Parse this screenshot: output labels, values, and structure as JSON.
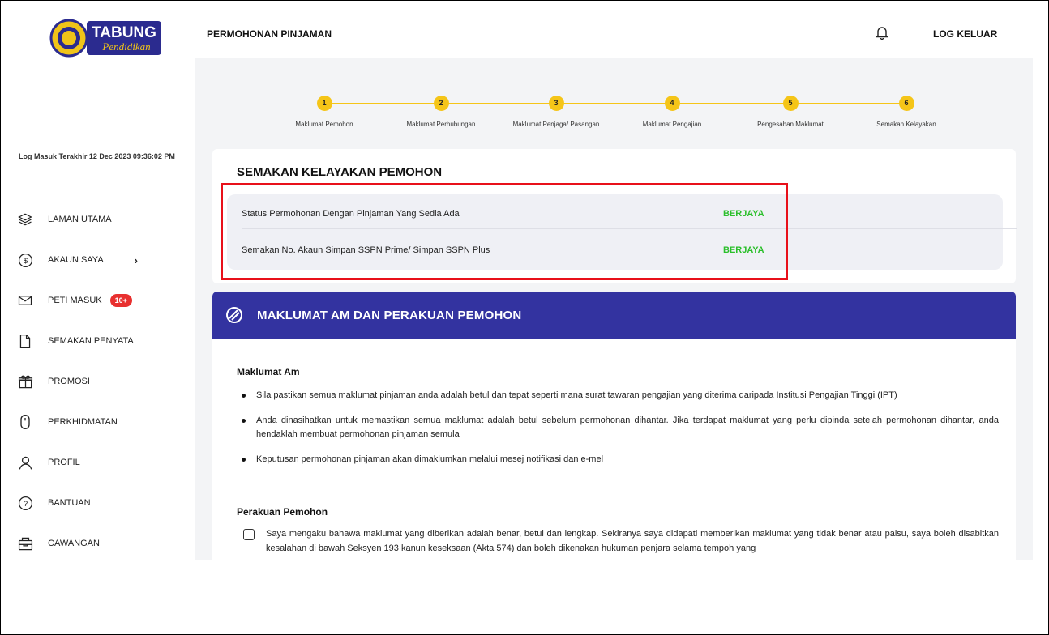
{
  "app": {
    "logo_text": "TABUNG",
    "logo_subtext": "Pendidikan"
  },
  "header": {
    "title": "PERMOHONAN PINJAMAN",
    "logout_label": "LOG KELUAR"
  },
  "sidebar": {
    "last_login": "Log Masuk Terakhir 12 Dec 2023 09:36:02 PM",
    "items": [
      {
        "label": "LAMAN UTAMA",
        "icon": "layers-icon"
      },
      {
        "label": "AKAUN SAYA",
        "icon": "dollar-circle-icon",
        "chevron": "›"
      },
      {
        "label": "PETI MASUK",
        "icon": "mail-icon",
        "badge": "10+"
      },
      {
        "label": "SEMAKAN PENYATA",
        "icon": "file-icon"
      },
      {
        "label": "PROMOSI",
        "icon": "gift-icon"
      },
      {
        "label": "PERKHIDMATAN",
        "icon": "mouse-icon"
      },
      {
        "label": "PROFIL",
        "icon": "user-icon"
      },
      {
        "label": "BANTUAN",
        "icon": "help-icon"
      },
      {
        "label": "CAWANGAN",
        "icon": "building-icon"
      }
    ]
  },
  "stepper": {
    "steps": [
      {
        "num": "1",
        "label": "Maklumat Pemohon"
      },
      {
        "num": "2",
        "label": "Maklumat Perhubungan"
      },
      {
        "num": "3",
        "label": "Maklumat Penjaga/ Pasangan"
      },
      {
        "num": "4",
        "label": "Maklumat Pengajian"
      },
      {
        "num": "5",
        "label": "Pengesahan Maklumat"
      },
      {
        "num": "6",
        "label": "Semakan Kelayakan"
      }
    ],
    "color": "#f5c518"
  },
  "eligibility": {
    "title": "SEMAKAN KELAYAKAN PEMOHON",
    "rows": [
      {
        "label": "Status Permohonan Dengan Pinjaman Yang Sedia Ada",
        "status": "BERJAYA"
      },
      {
        "label": "Semakan No. Akaun Simpan SSPN Prime/ Simpan SSPN Plus",
        "status": "BERJAYA"
      }
    ],
    "status_color": "#2bbf2b"
  },
  "info": {
    "header_title": "MAKLUMAT AM DAN PERAKUAN PEMOHON",
    "section1_title": "Maklumat Am",
    "bullets": [
      "Sila pastikan semua maklumat pinjaman anda adalah betul dan tepat seperti mana surat tawaran pengajian yang diterima daripada Institusi Pengajian Tinggi (IPT)",
      "Anda dinasihatkan untuk memastikan semua maklumat adalah betul sebelum permohonan dihantar. Jika terdapat maklumat yang perlu dipinda setelah permohonan dihantar, anda hendaklah membuat permohonan pinjaman semula",
      "Keputusan permohonan pinjaman akan dimaklumkan melalui mesej notifikasi dan e-mel"
    ],
    "section2_title": "Perakuan Pemohon",
    "declaration": "Saya mengaku bahawa maklumat yang diberikan adalah benar, betul dan lengkap. Sekiranya saya didapati memberikan maklumat yang tidak benar atau palsu, saya boleh disabitkan kesalahan di bawah Seksyen 193 kanun keseksaan (Akta 574) dan boleh dikenakan hukuman penjara selama tempoh yang",
    "header_color": "#3333a0"
  }
}
